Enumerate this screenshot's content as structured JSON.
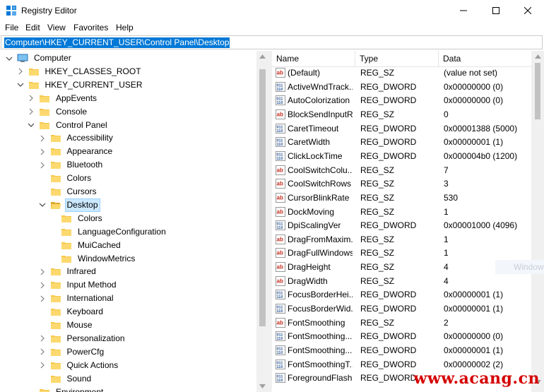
{
  "window": {
    "title": "Registry Editor"
  },
  "menu": [
    "File",
    "Edit",
    "View",
    "Favorites",
    "Help"
  ],
  "address": "Computer\\HKEY_CURRENT_USER\\Control Panel\\Desktop",
  "tree": [
    {
      "label": "Computer",
      "level": 0,
      "expanded": true,
      "icon": "computer"
    },
    {
      "label": "HKEY_CLASSES_ROOT",
      "level": 1,
      "expanded": false,
      "icon": "folder"
    },
    {
      "label": "HKEY_CURRENT_USER",
      "level": 1,
      "expanded": true,
      "icon": "folder"
    },
    {
      "label": "AppEvents",
      "level": 2,
      "expanded": false,
      "icon": "folder"
    },
    {
      "label": "Console",
      "level": 2,
      "expanded": false,
      "icon": "folder"
    },
    {
      "label": "Control Panel",
      "level": 2,
      "expanded": true,
      "icon": "folder"
    },
    {
      "label": "Accessibility",
      "level": 3,
      "expanded": false,
      "icon": "folder"
    },
    {
      "label": "Appearance",
      "level": 3,
      "expanded": false,
      "icon": "folder"
    },
    {
      "label": "Bluetooth",
      "level": 3,
      "expanded": false,
      "icon": "folder"
    },
    {
      "label": "Colors",
      "level": 3,
      "icon": "folder"
    },
    {
      "label": "Cursors",
      "level": 3,
      "icon": "folder"
    },
    {
      "label": "Desktop",
      "level": 3,
      "expanded": true,
      "selected": true,
      "icon": "folder-open"
    },
    {
      "label": "Colors",
      "level": 4,
      "icon": "folder"
    },
    {
      "label": "LanguageConfiguration",
      "level": 4,
      "icon": "folder"
    },
    {
      "label": "MuiCached",
      "level": 4,
      "icon": "folder"
    },
    {
      "label": "WindowMetrics",
      "level": 4,
      "icon": "folder"
    },
    {
      "label": "Infrared",
      "level": 3,
      "expanded": false,
      "icon": "folder"
    },
    {
      "label": "Input Method",
      "level": 3,
      "expanded": false,
      "icon": "folder"
    },
    {
      "label": "International",
      "level": 3,
      "expanded": false,
      "icon": "folder"
    },
    {
      "label": "Keyboard",
      "level": 3,
      "icon": "folder"
    },
    {
      "label": "Mouse",
      "level": 3,
      "icon": "folder"
    },
    {
      "label": "Personalization",
      "level": 3,
      "expanded": false,
      "icon": "folder"
    },
    {
      "label": "PowerCfg",
      "level": 3,
      "expanded": false,
      "icon": "folder"
    },
    {
      "label": "Quick Actions",
      "level": 3,
      "expanded": false,
      "icon": "folder"
    },
    {
      "label": "Sound",
      "level": 3,
      "icon": "folder"
    },
    {
      "label": "Environment",
      "level": 2,
      "icon": "folder"
    }
  ],
  "columns": {
    "name": "Name",
    "type": "Type",
    "data": "Data"
  },
  "values": [
    {
      "name": "(Default)",
      "type": "REG_SZ",
      "data": "(value not set)",
      "icon": "string"
    },
    {
      "name": "ActiveWndTrack...",
      "type": "REG_DWORD",
      "data": "0x00000000 (0)",
      "icon": "binary"
    },
    {
      "name": "AutoColorization",
      "type": "REG_DWORD",
      "data": "0x00000000 (0)",
      "icon": "binary"
    },
    {
      "name": "BlockSendInputR...",
      "type": "REG_SZ",
      "data": "0",
      "icon": "string"
    },
    {
      "name": "CaretTimeout",
      "type": "REG_DWORD",
      "data": "0x00001388 (5000)",
      "icon": "binary"
    },
    {
      "name": "CaretWidth",
      "type": "REG_DWORD",
      "data": "0x00000001 (1)",
      "icon": "binary"
    },
    {
      "name": "ClickLockTime",
      "type": "REG_DWORD",
      "data": "0x000004b0 (1200)",
      "icon": "binary"
    },
    {
      "name": "CoolSwitchColu...",
      "type": "REG_SZ",
      "data": "7",
      "icon": "string"
    },
    {
      "name": "CoolSwitchRows",
      "type": "REG_SZ",
      "data": "3",
      "icon": "string"
    },
    {
      "name": "CursorBlinkRate",
      "type": "REG_SZ",
      "data": "530",
      "icon": "string"
    },
    {
      "name": "DockMoving",
      "type": "REG_SZ",
      "data": "1",
      "icon": "string"
    },
    {
      "name": "DpiScalingVer",
      "type": "REG_DWORD",
      "data": "0x00001000 (4096)",
      "icon": "binary"
    },
    {
      "name": "DragFromMaxim...",
      "type": "REG_SZ",
      "data": "1",
      "icon": "string"
    },
    {
      "name": "DragFullWindows",
      "type": "REG_SZ",
      "data": "1",
      "icon": "string"
    },
    {
      "name": "DragHeight",
      "type": "REG_SZ",
      "data": "4",
      "icon": "string"
    },
    {
      "name": "DragWidth",
      "type": "REG_SZ",
      "data": "4",
      "icon": "string"
    },
    {
      "name": "FocusBorderHei...",
      "type": "REG_DWORD",
      "data": "0x00000001 (1)",
      "icon": "binary"
    },
    {
      "name": "FocusBorderWid...",
      "type": "REG_DWORD",
      "data": "0x00000001 (1)",
      "icon": "binary"
    },
    {
      "name": "FontSmoothing",
      "type": "REG_SZ",
      "data": "2",
      "icon": "string"
    },
    {
      "name": "FontSmoothing...",
      "type": "REG_DWORD",
      "data": "0x00000000 (0)",
      "icon": "binary"
    },
    {
      "name": "FontSmoothing...",
      "type": "REG_DWORD",
      "data": "0x00000001 (1)",
      "icon": "binary"
    },
    {
      "name": "FontSmoothingT...",
      "type": "REG_DWORD",
      "data": "0x00000002 (2)",
      "icon": "binary"
    },
    {
      "name": "ForegroundFlash...",
      "type": "REG_DWORD",
      "data": "",
      "icon": "binary"
    }
  ],
  "ghost_label": "Window",
  "watermark": "www.acang.cn",
  "colors": {
    "accent": "#0078d7",
    "selection": "#cce8ff",
    "folder": "#f5c84c",
    "string_icon": "#c42b1c",
    "binary_icon": "#2b5797"
  }
}
